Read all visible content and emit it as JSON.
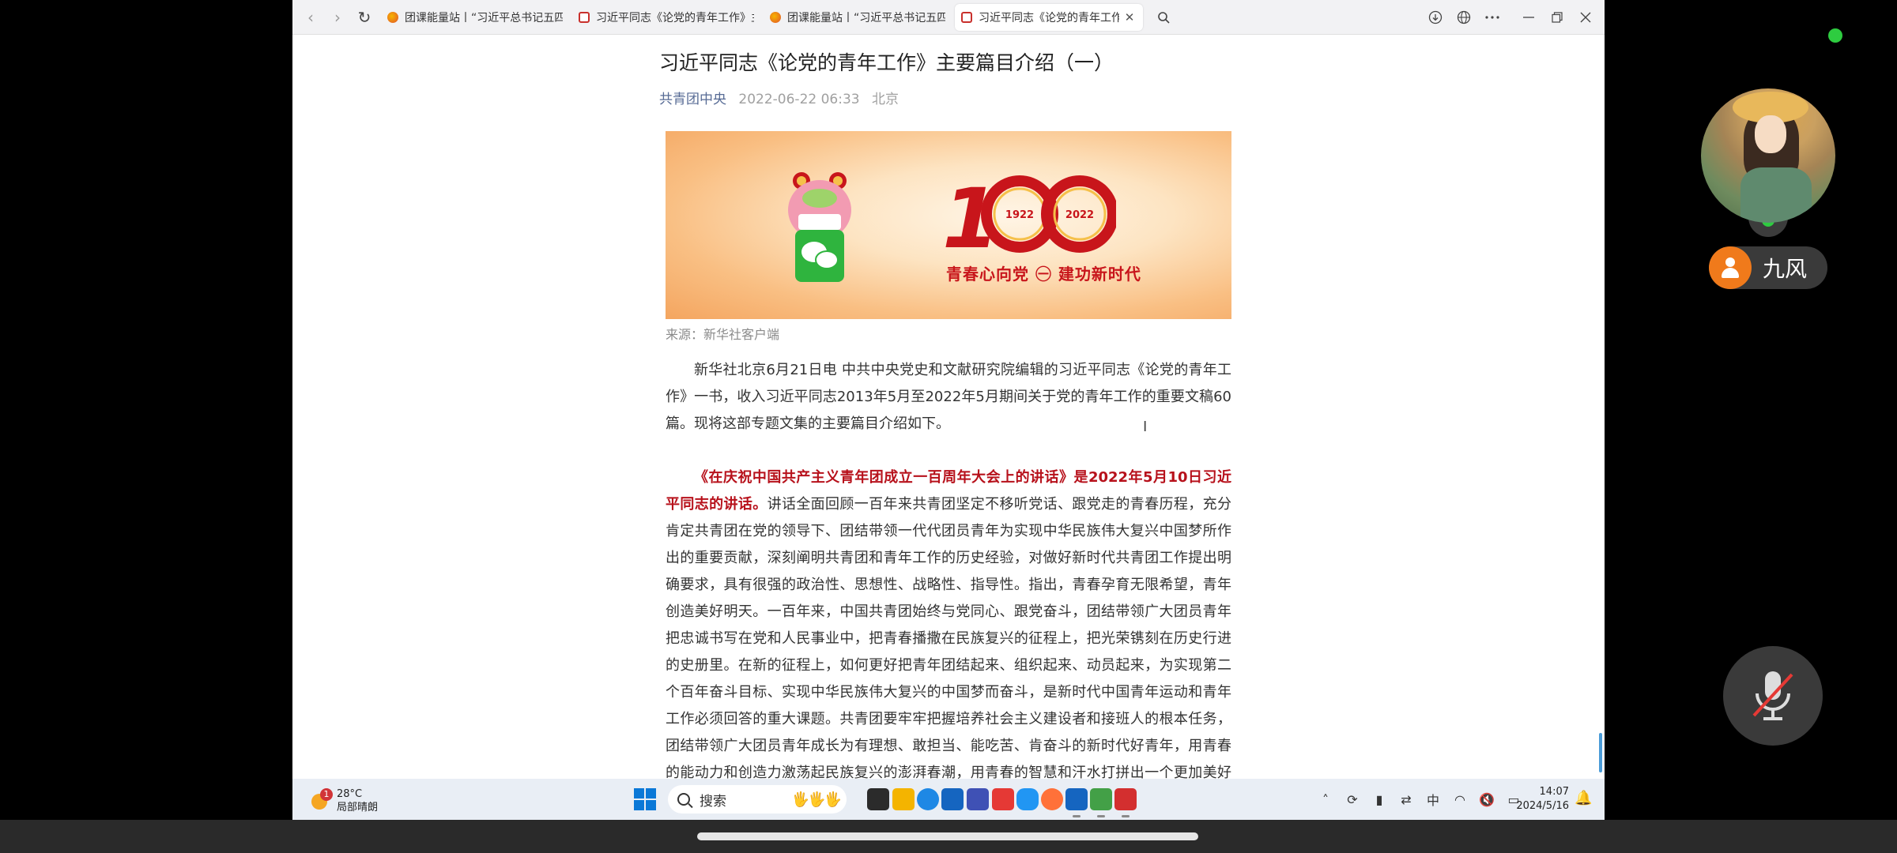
{
  "browser": {
    "tabs": [
      {
        "label": "团课能量站丨“习近平总书记五四寄语",
        "favicon": "orange"
      },
      {
        "label": "习近平同志《论党的青年工作》主要",
        "favicon": "red"
      },
      {
        "label": "团课能量站丨“习近平总书记五四寄语",
        "favicon": "orange"
      },
      {
        "label": "习近平同志《论党的青年工作》主要篇",
        "favicon": "red",
        "selected": true
      }
    ],
    "close_glyph": "✕",
    "icons": [
      "back-icon",
      "forward-icon",
      "refresh-icon",
      "search-tab-icon",
      "download-icon",
      "globe-icon",
      "more-icon",
      "minimize-icon",
      "restore-icon",
      "close-window-icon"
    ]
  },
  "article": {
    "title": "习近平同志《论党的青年工作》主要篇目介绍（一）",
    "author": "共青团中央",
    "datetime": "2022-06-22 06:33",
    "location": "北京",
    "banner": {
      "slogan": "青春心向党 ㊀ 建功新时代",
      "number": "100",
      "year_start": "1922",
      "year_end": "2022"
    },
    "source": "来源：新华社客户端",
    "p1": "新华社北京6月21日电 中共中央党史和文献研究院编辑的习近平同志《论党的青年工作》一书，收入习近平同志2013年5月至2022年5月期间关于党的青年工作的重要文稿60篇。现将这部专题文集的主要篇目介绍如下。",
    "p2_bold": "《在庆祝中国共产主义青年团成立一百周年大会上的讲话》是2022年5月10日习近平同志的讲话。",
    "p2_rest": "讲话全面回顾一百年来共青团坚定不移听党话、跟党走的青春历程，充分肯定共青团在党的领导下、团结带领一代代团员青年为实现中华民族伟大复兴中国梦所作出的重要贡献，深刻阐明共青团和青年工作的历史经验，对做好新时代共青团工作提出明确要求，具有很强的政治性、思想性、战略性、指导性。指出，青春孕育无限希望，青年创造美好明天。一百年来，中国共青团始终与党同心、跟党奋斗，团结带领广大团员青年把忠诚书写在党和人民事业中，把青春播撒在民族复兴的征程上，把光荣镌刻在历史行进的史册里。在新的征程上，如何更好把青年团结起来、组织起来、动员起来，为实现第二个百年奋斗目标、实现中华民族伟大复兴的中国梦而奋斗，是新时代中国青年运动和青年工作必须回答的重大课题。共青团要牢牢把握培养社会主义建设者和接班人的根本任务，团结带领广大团员青年成长为有理想、敢担当、能吃苦、肯奋斗的新时代好青年，用青春的能动力和创造力激荡起民族复兴的澎湃春潮，用青春的智慧和汗水打拼出一个更加美好的"
  },
  "taskbar": {
    "weather_temp": "28°C",
    "weather_desc": "局部晴朗",
    "weather_badge": "1",
    "search_placeholder": "搜索",
    "ime": "中",
    "time": "14:07",
    "date": "2024/5/16",
    "apps": [
      {
        "name": "task-view",
        "color": "#2b2b2b"
      },
      {
        "name": "file-explorer",
        "color": "#f4b400"
      },
      {
        "name": "edge",
        "color": "#1e88e5"
      },
      {
        "name": "store",
        "color": "#1565c0"
      },
      {
        "name": "app-blue",
        "color": "#3f51b5"
      },
      {
        "name": "app-red",
        "color": "#e53935"
      },
      {
        "name": "onedrive",
        "color": "#2196f3"
      },
      {
        "name": "firefox",
        "color": "#ff7139"
      },
      {
        "name": "photos",
        "color": "#1565c0"
      },
      {
        "name": "remote-app",
        "color": "#43a047"
      },
      {
        "name": "wps",
        "color": "#d32f2f"
      }
    ]
  },
  "call": {
    "username": "九风"
  },
  "colors": {
    "accent_blue": "#576b95",
    "highlight_red": "#b7111b",
    "call_orange": "#f07a1b",
    "online_green": "#2ecc40"
  }
}
